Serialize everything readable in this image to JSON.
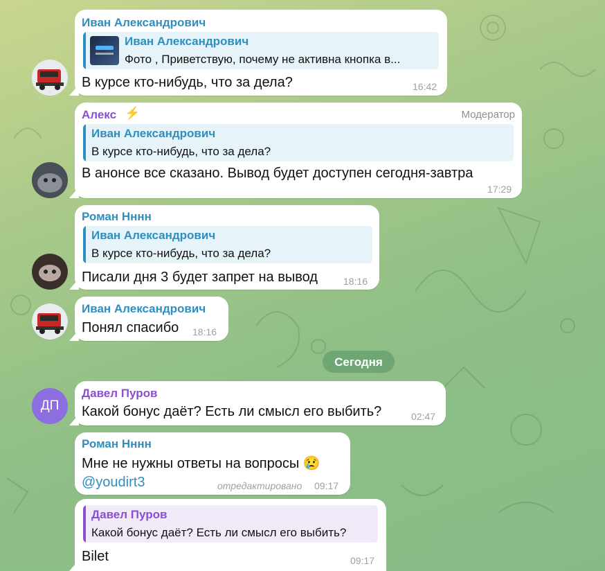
{
  "messages": {
    "m1": {
      "sender": "Иван Александрович",
      "reply_name": "Иван Александрович",
      "reply_text": "Фото , Приветствую, почему не активна кнопка в...",
      "text": "В курсе кто-нибудь, что за дела?",
      "time": "16:42"
    },
    "m2": {
      "sender": "Алекс",
      "role": "Модератор",
      "reply_name": "Иван Александрович",
      "reply_text": "В курсе кто-нибудь, что за дела?",
      "text": "В анонсе все сказано. Вывод будет доступен сегодня-завтра",
      "time": "17:29"
    },
    "m3": {
      "sender": "Роман Нннн",
      "reply_name": "Иван Александрович",
      "reply_text": "В курсе кто-нибудь, что за дела?",
      "text": "Писали дня 3 будет запрет на вывод",
      "time": "18:16"
    },
    "m4": {
      "sender": "Иван Александрович",
      "text": "Понял спасибо",
      "time": "18:16"
    },
    "date_divider": "Сегодня",
    "m5": {
      "sender": "Давел Пуров",
      "avatar_initials": "ДП",
      "text": "Какой бонус даёт? Есть ли смысл его выбить?",
      "time": "02:47"
    },
    "m6": {
      "sender": "Роман Нннн",
      "text": "Мне не нужны ответы на вопросы 😢",
      "mention": "@youdirt3",
      "edited": "отредактировано",
      "time": "09:17"
    },
    "m7": {
      "reply_name": "Давел Пуров",
      "reply_text": "Какой бонус даёт? Есть ли смысл его выбить?",
      "text": "Bilet",
      "time": "09:17"
    }
  },
  "icons": {
    "lightning": "lightning-icon",
    "truck_avatar": "truck-avatar",
    "photo_thumbnail": "photo-thumbnail"
  },
  "colors": {
    "name_blue": "#2f8ec0",
    "name_purple": "#8a4fcf",
    "date_pill": "#6fa774",
    "avatar_dp": "#8c6ee0"
  }
}
